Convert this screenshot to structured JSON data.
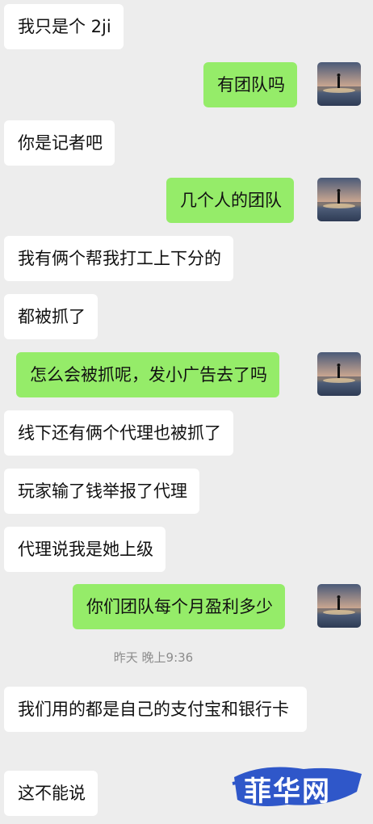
{
  "messages": [
    {
      "side": "in",
      "text": "我只是个 2ji"
    },
    {
      "side": "out",
      "text": "有团队吗"
    },
    {
      "side": "in",
      "text": "你是记者吧"
    },
    {
      "side": "out",
      "text": "几个人的团队"
    },
    {
      "side": "in",
      "text": "我有俩个帮我打工上下分的"
    },
    {
      "side": "in",
      "text": "都被抓了"
    },
    {
      "side": "out",
      "text": "怎么会被抓呢，发小广告去了吗"
    },
    {
      "side": "in",
      "text": "线下还有俩个代理也被抓了"
    },
    {
      "side": "in",
      "text": "玩家输了钱举报了代理"
    },
    {
      "side": "in",
      "text": "代理说我是她上级"
    },
    {
      "side": "out",
      "text": "你们团队每个月盈利多少"
    },
    {
      "side": "in",
      "text": "我们用的都是自己的支付宝和银行卡"
    },
    {
      "side": "in",
      "text": "这不能说"
    }
  ],
  "timestamp": "昨天 晚上9:36",
  "watermark": "菲华网",
  "colors": {
    "background": "#ededed",
    "incoming": "#ffffff",
    "outgoing": "#95ec69",
    "watermark": "#2f57c9"
  }
}
